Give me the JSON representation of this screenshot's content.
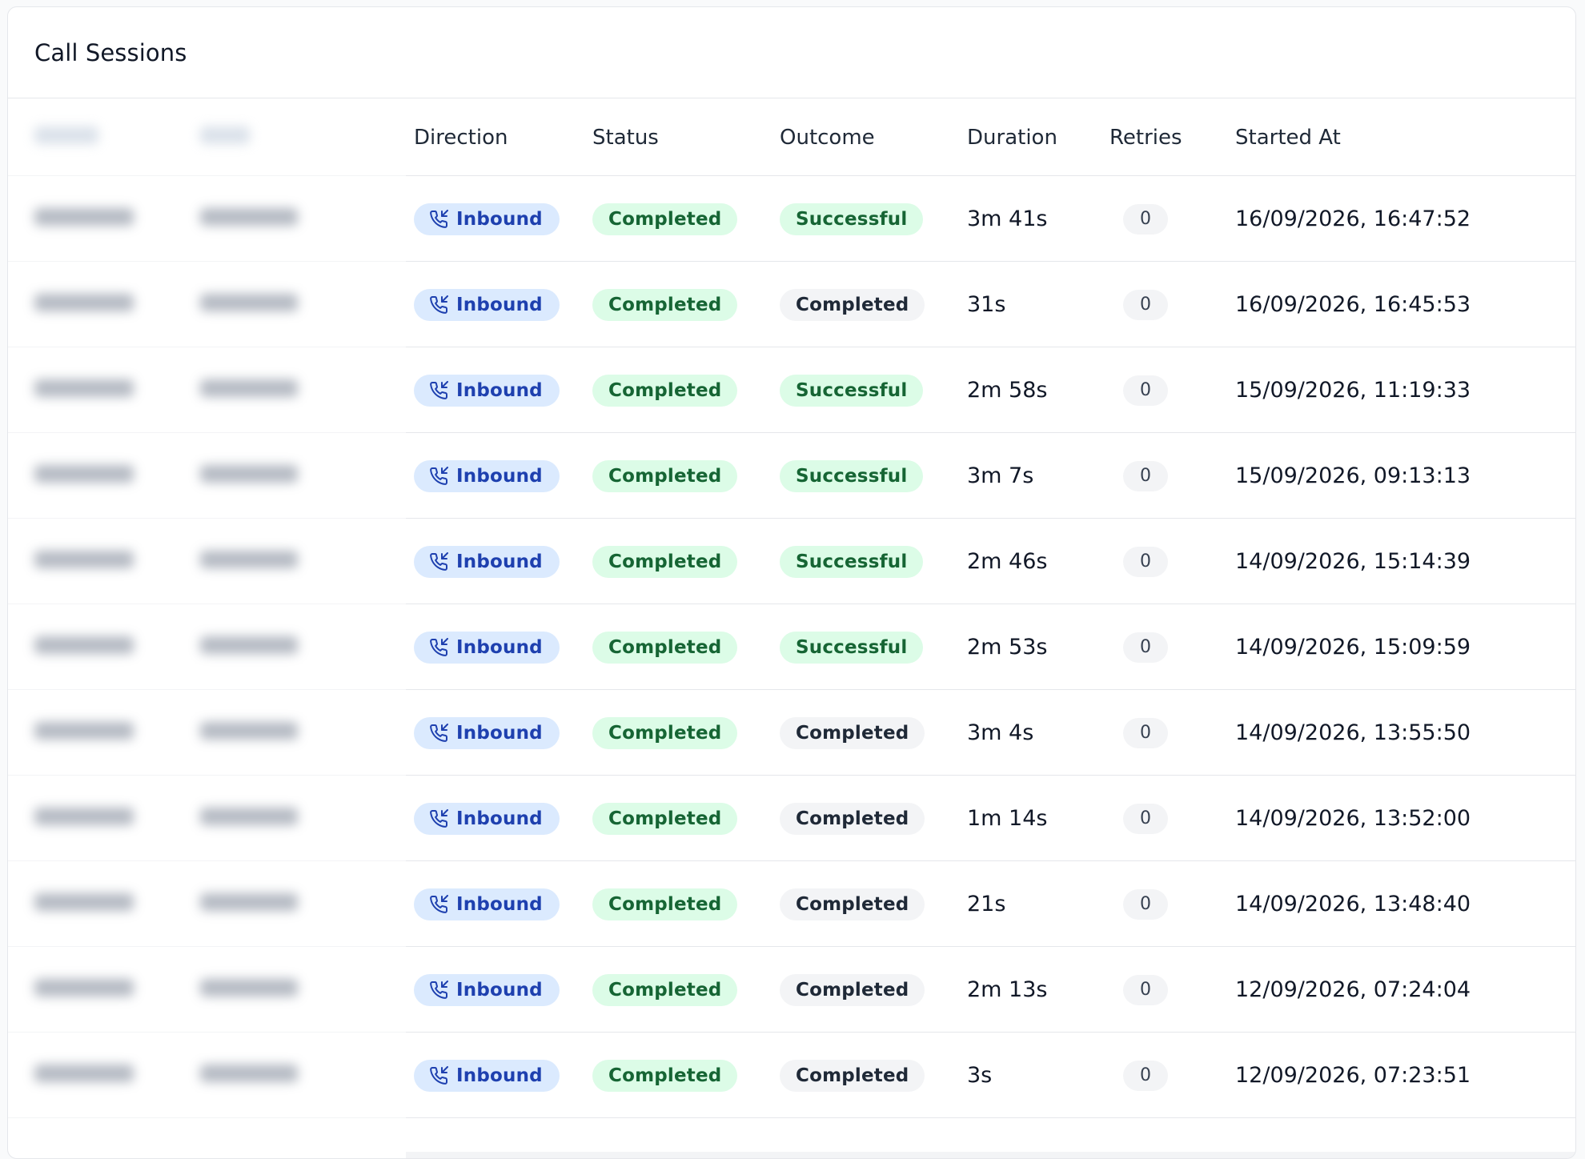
{
  "card": {
    "title": "Call Sessions"
  },
  "columns": {
    "direction": "Direction",
    "status": "Status",
    "outcome": "Outcome",
    "duration": "Duration",
    "retries": "Retries",
    "started_at": "Started At"
  },
  "colors": {
    "direction_badge_bg": "#dbeafe",
    "direction_badge_fg": "#1e40af",
    "success_badge_bg": "#dcfce7",
    "success_badge_fg": "#166534",
    "neutral_badge_bg": "#f3f4f6",
    "neutral_badge_fg": "#1f2937"
  },
  "icons": {
    "direction": "phone-incoming-icon"
  },
  "rows": [
    {
      "direction": "Inbound",
      "status": "Completed",
      "outcome": "Successful",
      "outcome_tone": "green",
      "duration": "3m 41s",
      "retries": "0",
      "started_at": "16/09/2026, 16:47:52"
    },
    {
      "direction": "Inbound",
      "status": "Completed",
      "outcome": "Completed",
      "outcome_tone": "gray",
      "duration": "31s",
      "retries": "0",
      "started_at": "16/09/2026, 16:45:53"
    },
    {
      "direction": "Inbound",
      "status": "Completed",
      "outcome": "Successful",
      "outcome_tone": "green",
      "duration": "2m 58s",
      "retries": "0",
      "started_at": "15/09/2026, 11:19:33"
    },
    {
      "direction": "Inbound",
      "status": "Completed",
      "outcome": "Successful",
      "outcome_tone": "green",
      "duration": "3m 7s",
      "retries": "0",
      "started_at": "15/09/2026, 09:13:13"
    },
    {
      "direction": "Inbound",
      "status": "Completed",
      "outcome": "Successful",
      "outcome_tone": "green",
      "duration": "2m 46s",
      "retries": "0",
      "started_at": "14/09/2026, 15:14:39"
    },
    {
      "direction": "Inbound",
      "status": "Completed",
      "outcome": "Successful",
      "outcome_tone": "green",
      "duration": "2m 53s",
      "retries": "0",
      "started_at": "14/09/2026, 15:09:59"
    },
    {
      "direction": "Inbound",
      "status": "Completed",
      "outcome": "Completed",
      "outcome_tone": "gray",
      "duration": "3m 4s",
      "retries": "0",
      "started_at": "14/09/2026, 13:55:50"
    },
    {
      "direction": "Inbound",
      "status": "Completed",
      "outcome": "Completed",
      "outcome_tone": "gray",
      "duration": "1m 14s",
      "retries": "0",
      "started_at": "14/09/2026, 13:52:00"
    },
    {
      "direction": "Inbound",
      "status": "Completed",
      "outcome": "Completed",
      "outcome_tone": "gray",
      "duration": "21s",
      "retries": "0",
      "started_at": "14/09/2026, 13:48:40"
    },
    {
      "direction": "Inbound",
      "status": "Completed",
      "outcome": "Completed",
      "outcome_tone": "gray",
      "duration": "2m 13s",
      "retries": "0",
      "started_at": "12/09/2026, 07:24:04"
    },
    {
      "direction": "Inbound",
      "status": "Completed",
      "outcome": "Completed",
      "outcome_tone": "gray",
      "duration": "3s",
      "retries": "0",
      "started_at": "12/09/2026, 07:23:51"
    }
  ]
}
